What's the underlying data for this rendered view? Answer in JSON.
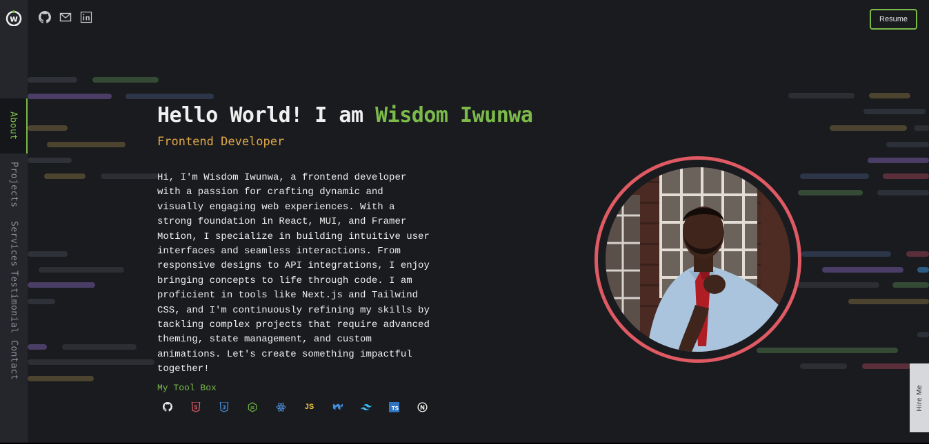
{
  "brand": {
    "logo_letter": "w"
  },
  "top_icons": [
    "github-icon",
    "mail-icon",
    "linkedin-icon"
  ],
  "header": {
    "resume_label": "Resume"
  },
  "nav": {
    "items": [
      {
        "label": "About",
        "active": true
      },
      {
        "label": "Projects",
        "active": false
      },
      {
        "label": "Services",
        "active": false
      },
      {
        "label": "Testimonial",
        "active": false
      },
      {
        "label": "Contact",
        "active": false
      }
    ]
  },
  "hero": {
    "greeting": "Hello World! I am ",
    "name": "Wisdom Iwunwa",
    "role": "Frontend Developer",
    "bio": "Hi, I'm Wisdom Iwunwa, a frontend developer with a passion for crafting dynamic and visually engaging web experiences. With a strong foundation in React, MUI, and Framer Motion, I specialize in building intuitive user interfaces and seamless interactions. From responsive designs to API integrations, I enjoy bringing concepts to life through code. I am proficient in tools like Next.js and Tailwind CSS, and I'm continuously refining my skills by tackling complex projects that require advanced theming, state management, and custom animations. Let's create something impactful together!"
  },
  "toolbox": {
    "title": "My Tool Box",
    "tools": [
      {
        "icon": "github-icon",
        "text": ""
      },
      {
        "icon": "html5-icon",
        "text": "5"
      },
      {
        "icon": "css3-icon",
        "text": "3"
      },
      {
        "icon": "nodejs-icon",
        "text": "JS"
      },
      {
        "icon": "react-icon",
        "text": ""
      },
      {
        "icon": "javascript-icon",
        "text": "JS"
      },
      {
        "icon": "mui-icon",
        "text": ""
      },
      {
        "icon": "tailwind-icon",
        "text": ""
      },
      {
        "icon": "typescript-icon",
        "text": "TS"
      },
      {
        "icon": "nextjs-icon",
        "text": "N"
      }
    ]
  },
  "hire": {
    "label": "Hire Me"
  },
  "colors": {
    "background": "#1a1b1f",
    "sidebar": "#24262b",
    "accent_green": "#7cba4a",
    "accent_orange": "#e0a94a",
    "ring_red": "#e05a63"
  }
}
